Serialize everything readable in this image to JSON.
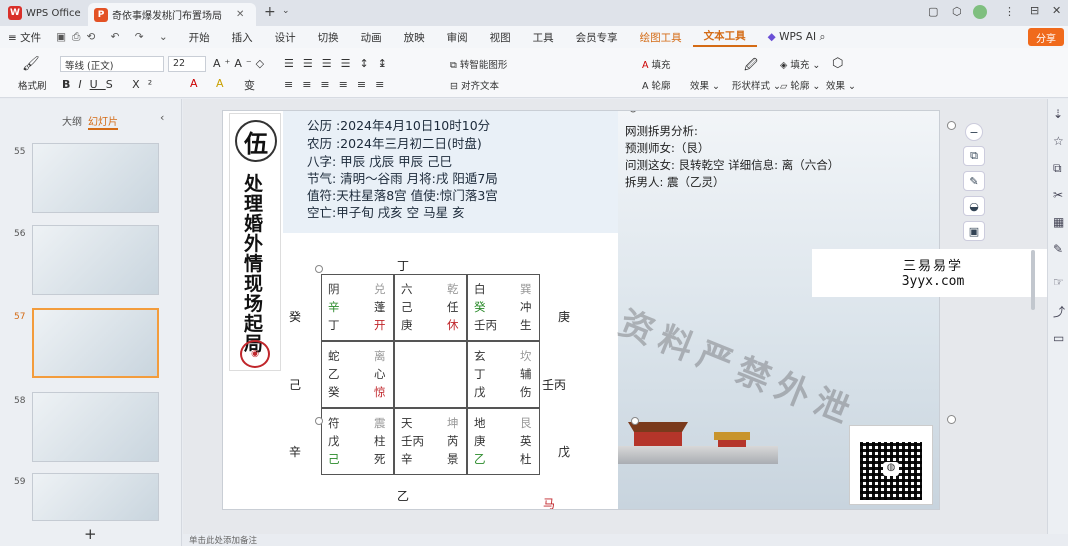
{
  "titlebar": {
    "home_tab": "WPS Office",
    "doc_tab": "奇依事爆发桃门布置场局"
  },
  "menu": {
    "file": "文件",
    "items": [
      "开始",
      "插入",
      "设计",
      "切换",
      "动画",
      "放映",
      "审阅",
      "视图",
      "工具",
      "会员专享"
    ],
    "drawing_tools": "绘图工具",
    "text_tools": "文本工具",
    "wps_ai": "WPS AI",
    "share": "分享"
  },
  "ribbon": {
    "format_painter": "格式刷",
    "font_name": "等线 (正文)",
    "font_size": "22",
    "smart_shape": "转智能图形",
    "align_text": "对齐文本",
    "fill": "填充",
    "outline": "轮廓",
    "effects": "效果",
    "shape_style": "形状样式",
    "shape_fill": "填充",
    "shape_outline": "轮廓",
    "shape_effects": "效果"
  },
  "left_panel": {
    "tab_outline": "大纲",
    "tab_slides": "幻灯片",
    "slide_numbers": [
      "55",
      "56",
      "57",
      "58",
      "59"
    ],
    "add": "+"
  },
  "slide": {
    "seal_char": "伍",
    "vertical_title": "处理婚外情现场起局",
    "info": [
      "公历 :2024年4月10日10时10分",
      "农历 :2024年三月初二日(时盘)",
      "八字: 甲辰  戊辰  甲辰  己巳",
      "节气: 清明～谷雨 月将:戌 阳遁7局",
      "值符:天柱星落8宫 值使:惊门落3宫",
      "空亡:甲子旬 戌亥 空 马星 亥"
    ],
    "analysis": [
      "网测拆男分析:",
      "预测师女:（艮）",
      "问测这女: 艮转乾空 详细信息: 离（六合）",
      "拆男人: 震（乙灵）"
    ],
    "top_stem": "丁",
    "bottom_stem": "乙",
    "left_stems": [
      "癸",
      "己",
      "辛"
    ],
    "right_stems": [
      "庚",
      "壬丙",
      "戊"
    ],
    "horse": "马",
    "watermark": "资料严禁外泄",
    "palaces": [
      {
        "god": "阴",
        "gua": "兑",
        "stem1": "辛",
        "star": "蓬",
        "stem2": "丁",
        "door": "开"
      },
      {
        "god": "六",
        "gua": "乾",
        "stem1": "己",
        "star": "任",
        "stem2": "庚",
        "door": "休"
      },
      {
        "god": "白",
        "gua": "巽",
        "stem1": "癸",
        "star": "冲",
        "stem2": "壬丙",
        "door": "生"
      },
      {
        "god": "蛇",
        "gua": "离",
        "stem1": "乙",
        "star": "心",
        "stem2": "癸",
        "door": "惊"
      },
      {
        "god": "",
        "gua": "",
        "stem1": "",
        "star": "",
        "stem2": "",
        "door": ""
      },
      {
        "god": "玄",
        "gua": "坎",
        "stem1": "丁",
        "star": "辅",
        "stem2": "戊",
        "door": "伤"
      },
      {
        "god": "符",
        "gua": "震",
        "stem1": "戊",
        "star": "柱",
        "stem2": "己",
        "door": "死"
      },
      {
        "god": "天",
        "gua": "坤",
        "stem1": "壬丙",
        "star": "芮",
        "stem2": "辛",
        "door": "景"
      },
      {
        "god": "地",
        "gua": "艮",
        "stem1": "庚",
        "star": "英",
        "stem2": "乙",
        "door": "杜"
      }
    ],
    "brand_cn": "三易易学",
    "brand_url": "3yyx.com"
  },
  "statusbar": {
    "notes": "单击此处添加备注"
  },
  "colors": {
    "accent": "#d46b15",
    "share": "#f06a1c",
    "selected_thumb": "#f39c3c"
  }
}
